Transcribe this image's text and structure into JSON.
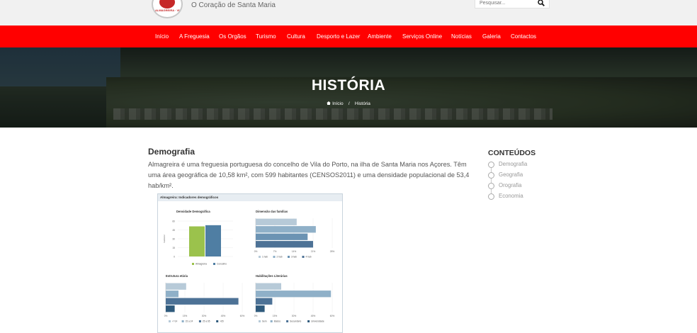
{
  "header": {
    "tagline": "O Coração de Santa Maria",
    "search_placeholder": "Pesquisar...",
    "logo_text": "ALMAGREIRA · VILA DO PORTO"
  },
  "nav": {
    "items": [
      "Início",
      "A Freguesia",
      "Os Orgãos",
      "Turismo",
      "Cultura",
      "Desporto e Lazer",
      "Ambiente",
      "Serviços Online",
      "Notícias",
      "Galeria",
      "Contactos"
    ]
  },
  "hero": {
    "title": "HISTÓRIA",
    "breadcrumb_home": "Início",
    "breadcrumb_sep": "/",
    "breadcrumb_current": "História"
  },
  "article": {
    "title": "Demografia",
    "text": "Almagreira é uma freguesia portuguesa do concelho de Vila do Porto, na ilha de Santa Maria nos Açores. Têm uma área geográfica de 10,58 km², com 599 habitantes (CENSOS2011) e uma densidade populacional de 53,4 hab/km²."
  },
  "figure": {
    "header": "Almagreira: Indicadores demográficos"
  },
  "chart_data": [
    {
      "type": "bar",
      "title": "Densidade Demográfica",
      "ylabel": "hab/km2",
      "categories": [
        "Almagreira",
        "Concelho"
      ],
      "values": [
        51,
        53
      ],
      "ylim": [
        0,
        60
      ],
      "yticks": [
        "60",
        "45",
        "30",
        "15",
        "0"
      ],
      "colors": [
        "#9bc24c",
        "#4f7ea3"
      ]
    },
    {
      "type": "bar",
      "orientation": "horizontal",
      "title": "Dimensão das famílias",
      "categories": [
        "1 hab",
        "2 hab",
        "3 hab",
        "4 hab"
      ],
      "values": [
        15,
        22,
        19,
        21
      ],
      "xlim": [
        0,
        28
      ],
      "xticks": [
        "0%",
        "7%",
        "14%",
        "21%",
        "28%"
      ],
      "colors": [
        "#b7cad8",
        "#8fb0c8",
        "#6b93b3",
        "#4d7296"
      ]
    },
    {
      "type": "bar",
      "orientation": "horizontal",
      "title": "Estrutura etária",
      "categories": [
        "<=14",
        "15 a 24",
        "25 a 65",
        ">65"
      ],
      "values": [
        16,
        10,
        57,
        7
      ],
      "xlim": [
        0,
        60
      ],
      "xticks": [
        "0%",
        "15%",
        "30%",
        "45%",
        "60%"
      ],
      "colors": [
        "#b7cad8",
        "#8fb0c8",
        "#4d7296",
        "#2f5a7c"
      ]
    },
    {
      "type": "bar",
      "orientation": "horizontal",
      "title": "Habilitações Literárias",
      "categories": [
        "Sem",
        "Básico",
        "Secundário",
        "Universidade"
      ],
      "values": [
        20,
        59,
        13,
        7
      ],
      "xlim": [
        0,
        60
      ],
      "xticks": [
        "0%",
        "15%",
        "30%",
        "45%",
        "60%"
      ],
      "colors": [
        "#b7cad8",
        "#8fb0c8",
        "#4d7296",
        "#2f5a7c"
      ]
    }
  ],
  "sidebar": {
    "title": "CONTEÚDOS",
    "items": [
      "Demografia",
      "Geografia",
      "Orografia",
      "Economia"
    ]
  }
}
